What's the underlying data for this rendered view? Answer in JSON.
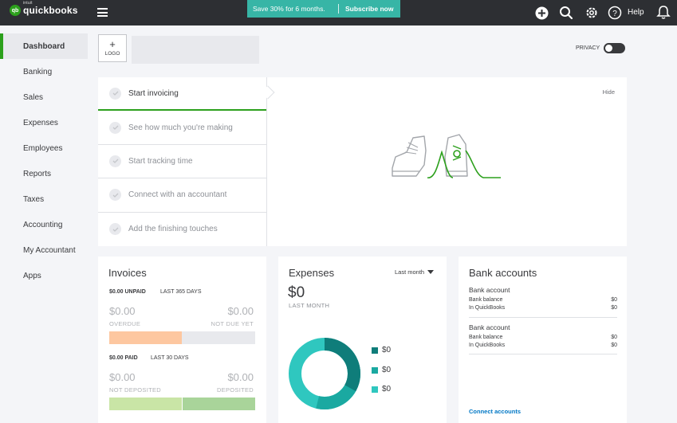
{
  "topbar": {
    "logo_small": "intuit",
    "logo_text": "quickbooks",
    "logo_badge": "qb",
    "promo_text": "Save 30% for 6 months.",
    "promo_link": "Subscribe now",
    "help_label": "Help",
    "icons": [
      "plus-circle-icon",
      "search-icon",
      "gear-icon",
      "help-icon",
      "bell-icon"
    ]
  },
  "sidebar": {
    "items": [
      {
        "label": "Dashboard",
        "active": true
      },
      {
        "label": "Banking"
      },
      {
        "label": "Sales"
      },
      {
        "label": "Expenses"
      },
      {
        "label": "Employees"
      },
      {
        "label": "Reports"
      },
      {
        "label": "Taxes"
      },
      {
        "label": "Accounting"
      },
      {
        "label": "My Accountant"
      },
      {
        "label": "Apps"
      }
    ]
  },
  "header": {
    "logo_plus": "+",
    "logo_label": "LOGO",
    "privacy_label": "PRIVACY"
  },
  "setup": {
    "hide_label": "Hide",
    "steps": [
      {
        "label": "Start invoicing",
        "active": true
      },
      {
        "label": "See how much you're making"
      },
      {
        "label": "Start tracking time"
      },
      {
        "label": "Connect with an accountant"
      },
      {
        "label": "Add the finishing touches"
      }
    ]
  },
  "invoices": {
    "title": "Invoices",
    "unpaid_amount": "$0.00 UNPAID",
    "unpaid_period": "LAST 365 DAYS",
    "overdue_value": "$0.00",
    "overdue_label": "OVERDUE",
    "not_due_value": "$0.00",
    "not_due_label": "NOT DUE YET",
    "paid_amount": "$0.00 PAID",
    "paid_period": "LAST 30 DAYS",
    "not_deposited_value": "$0.00",
    "not_deposited_label": "NOT DEPOSITED",
    "deposited_value": "$0.00",
    "deposited_label": "DEPOSITED",
    "colors": {
      "overdue": "#fdc7a0",
      "not_due": "#e8e9ed",
      "not_deposited": "#c9e5a6",
      "deposited": "#a9d49a"
    }
  },
  "expenses": {
    "title": "Expenses",
    "period_select": "Last month",
    "total": "$0",
    "total_label": "LAST MONTH",
    "legend": [
      {
        "value": "$0",
        "color": "#0f7d7a"
      },
      {
        "value": "$0",
        "color": "#1aa9a1"
      },
      {
        "value": "$0",
        "color": "#2fc7bf"
      }
    ],
    "donut_colors": [
      "#0f7d7a",
      "#1aa9a1",
      "#2fc7bf"
    ]
  },
  "bank": {
    "title": "Bank accounts",
    "accounts": [
      {
        "name": "Bank account",
        "balance_label": "Bank balance",
        "balance": "$0",
        "qb_label": "In QuickBooks",
        "qb": "$0"
      },
      {
        "name": "Bank account",
        "balance_label": "Bank balance",
        "balance": "$0",
        "qb_label": "In QuickBooks",
        "qb": "$0"
      }
    ],
    "connect_link": "Connect accounts"
  }
}
